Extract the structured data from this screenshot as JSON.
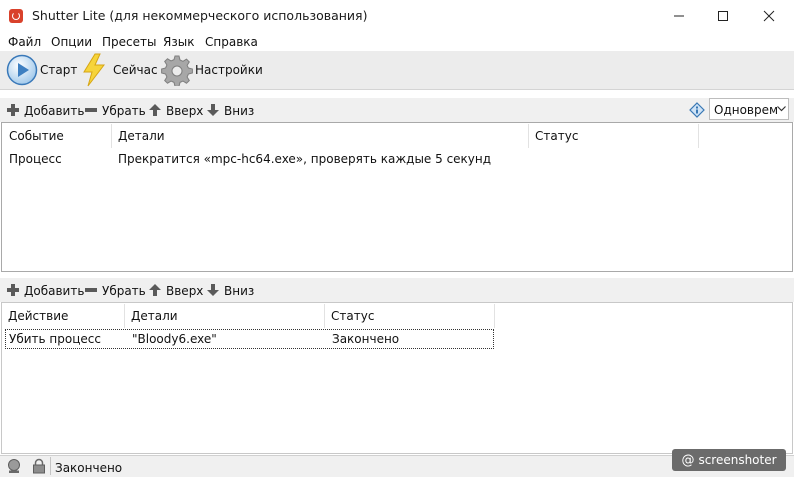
{
  "window": {
    "title": "Shutter Lite (для некоммерческого использования)"
  },
  "menu": [
    {
      "label": "Файл"
    },
    {
      "label": "Опции"
    },
    {
      "label": "Пресеты"
    },
    {
      "label": "Язык"
    },
    {
      "label": "Справка"
    }
  ],
  "toolbar": {
    "start": "Старт",
    "now": "Сейчас",
    "settings": "Настройки"
  },
  "events_bar": {
    "add": "Добавить",
    "remove": "Убрать",
    "up": "Вверх",
    "down": "Вниз",
    "mode_value": "Одноврем"
  },
  "events_table": {
    "headers": [
      "Событие",
      "Детали",
      "Статус"
    ],
    "rows": [
      {
        "event": "Процесс",
        "details": "Прекратится «mpc-hc64.exe», проверять каждые 5 секунд",
        "status": ""
      }
    ]
  },
  "actions_bar": {
    "add": "Добавить",
    "remove": "Убрать",
    "up": "Вверх",
    "down": "Вниз"
  },
  "actions_table": {
    "headers": [
      "Действие",
      "Детали",
      "Статус"
    ],
    "rows": [
      {
        "action": "Убить процесс",
        "details": "\"Bloody6.exe\"",
        "status": "Закончено"
      }
    ]
  },
  "status": {
    "text": "Закончено"
  },
  "watermark": {
    "text": "screenshoter"
  }
}
